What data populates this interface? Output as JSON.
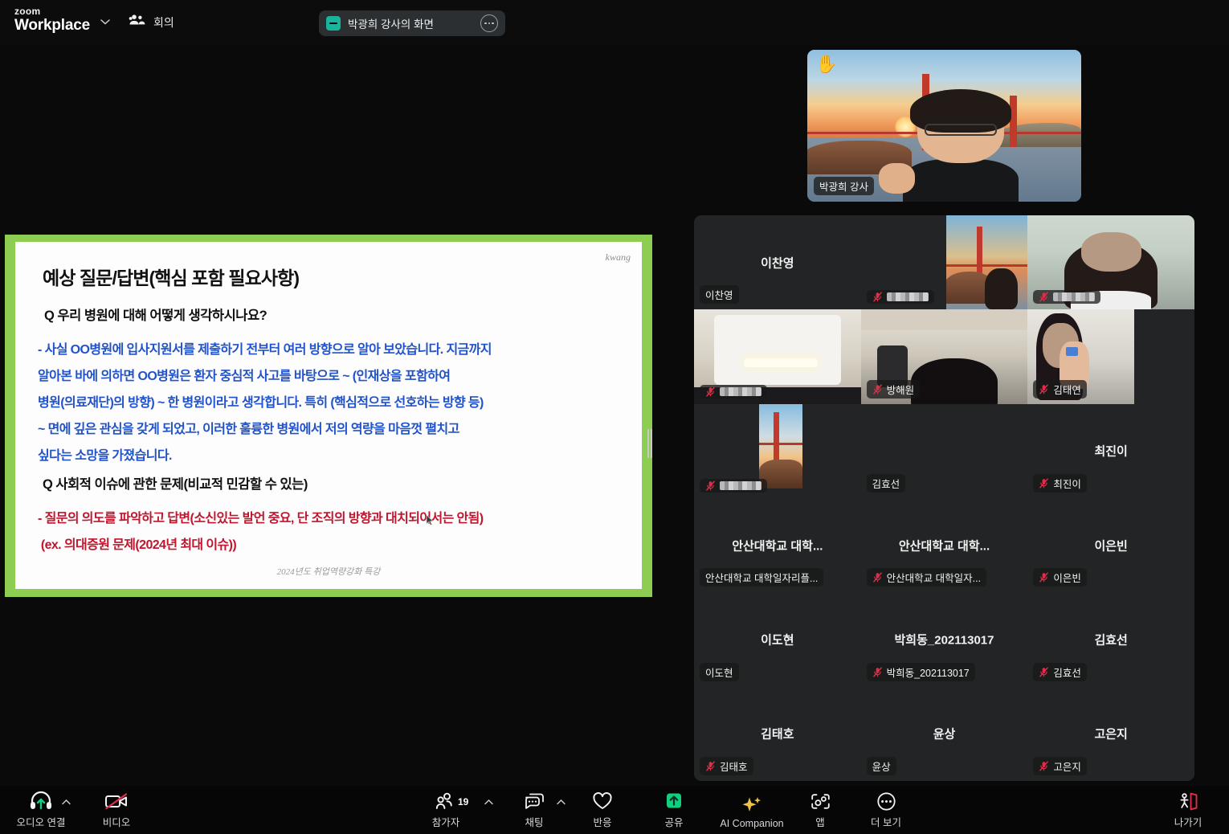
{
  "header": {
    "brand_top": "zoom",
    "brand_bottom": "Workplace",
    "brand_caret_icon": "chevron-down-icon",
    "meetings_icon": "people-group-icon",
    "meetings_label": "회의",
    "tab": {
      "share_icon": "screen-share-indicator-icon",
      "title": "박광희 강사의 화면",
      "more_icon": "more-options-icon"
    }
  },
  "slide": {
    "watermark": "kwang",
    "title": "예상 질문/답변(핵심 포함 필요사항)",
    "question_1": "Q 우리 병원에 대해 어떻게 생각하시나요?",
    "answer_1": "- 사실 OO병원에 입사지원서를 제출하기 전부터 여러 방향으로 알아 보았습니다. 지금까지 알아본 바에 의하면 OO병원은 환자 중심적 사고를 바탕으로 ~ (인재상을 포함하여 병원(의료재단)의 방향) ~ 한 병원이라고 생각합니다.  특히 (핵심적으로 선호하는 방향 등) ~ 면에 깊은 관심을 갖게 되었고, 이러한 훌륭한 병원에서 저의 역량을 마음껏 펼치고 싶다는 소망을 가졌습니다.",
    "question_2": "Q 사회적 이슈에 관한 문제(비교적 민감할 수 있는)",
    "answer_2": "- 질문의 의도를 파악하고 답변(소신있는 발언 중요, 단 조직의 방향과 대치되어서는 안됨)  (ex. 의대증원 문제(2024년 최대 이슈))",
    "footer": "2024년도 취업역량강화 특강",
    "colors": {
      "border": "#8DCE52",
      "answer_1_color": "#2052c9",
      "answer_2_color": "#c0152d"
    }
  },
  "speaker": {
    "raise_hand_icon": "raised-hand-icon",
    "name": "박광희 강사",
    "background": "golden-gate-bridge-virtual-background"
  },
  "grid": {
    "mute_icon": "microphone-muted-icon",
    "cells": [
      {
        "display_name": "이찬영",
        "corner_name": "이찬영",
        "muted": false,
        "has_video": false
      },
      {
        "display_name": "",
        "corner_name": "",
        "muted": true,
        "has_video": true,
        "name_blurred": true
      },
      {
        "display_name": "",
        "corner_name": "",
        "muted": true,
        "has_video": true,
        "name_blurred": true
      },
      {
        "display_name": "",
        "corner_name": "",
        "muted": true,
        "has_video": true,
        "name_blurred": true
      },
      {
        "display_name": "",
        "corner_name": "방해원",
        "muted": true,
        "has_video": true
      },
      {
        "display_name": "",
        "corner_name": "김태연",
        "muted": true,
        "has_video": true
      },
      {
        "display_name": "",
        "corner_name": "",
        "muted": true,
        "has_video": true,
        "name_blurred": true
      },
      {
        "display_name": "",
        "corner_name": "김효선",
        "muted": false,
        "has_video": true
      },
      {
        "display_name": "최진이",
        "corner_name": "최진이",
        "muted": true,
        "has_video": false
      },
      {
        "display_name": "안산대학교 대학...",
        "corner_name": "안산대학교 대학일자리플...",
        "muted": false,
        "has_video": false
      },
      {
        "display_name": "안산대학교 대학...",
        "corner_name": "안산대학교 대학일자...",
        "muted": true,
        "has_video": false
      },
      {
        "display_name": "이은빈",
        "corner_name": "이은빈",
        "muted": true,
        "has_video": false
      },
      {
        "display_name": "이도현",
        "corner_name": "이도현",
        "muted": false,
        "has_video": false
      },
      {
        "display_name": "박희동_202113017",
        "corner_name": "박희동_202113017",
        "muted": true,
        "has_video": false
      },
      {
        "display_name": "김효선",
        "corner_name": "김효선",
        "muted": true,
        "has_video": false
      },
      {
        "display_name": "김태호",
        "corner_name": "김태호",
        "muted": true,
        "has_video": false
      },
      {
        "display_name": "윤상",
        "corner_name": "윤상",
        "muted": false,
        "has_video": false
      },
      {
        "display_name": "고은지",
        "corner_name": "고은지",
        "muted": true,
        "has_video": false
      }
    ]
  },
  "toolbar": {
    "audio": {
      "icon": "headset-audio-icon",
      "label": "오디오 연결",
      "has_caret": true
    },
    "video": {
      "icon": "camera-off-icon",
      "label": "비디오",
      "has_caret": false
    },
    "participants": {
      "icon": "participants-icon",
      "label": "참가자",
      "count": "19",
      "has_caret": true
    },
    "chat": {
      "icon": "chat-bubble-icon",
      "label": "채팅",
      "has_caret": true
    },
    "reactions": {
      "icon": "heart-reaction-icon",
      "label": "반응",
      "has_caret": false
    },
    "share": {
      "icon": "share-screen-icon",
      "label": "공유",
      "has_caret": false,
      "accent": "#0fd07f"
    },
    "ai": {
      "icon": "ai-sparkle-icon",
      "label": "AI Companion",
      "has_caret": false,
      "accent": "#ecc14a"
    },
    "apps": {
      "icon": "apps-icon",
      "label": "앱",
      "has_caret": false
    },
    "more": {
      "icon": "more-horizontal-icon",
      "label": "더 보기",
      "has_caret": false
    },
    "leave": {
      "icon": "leave-meeting-icon",
      "label": "나가기",
      "has_caret": false,
      "accent": "#e02d4a"
    }
  }
}
